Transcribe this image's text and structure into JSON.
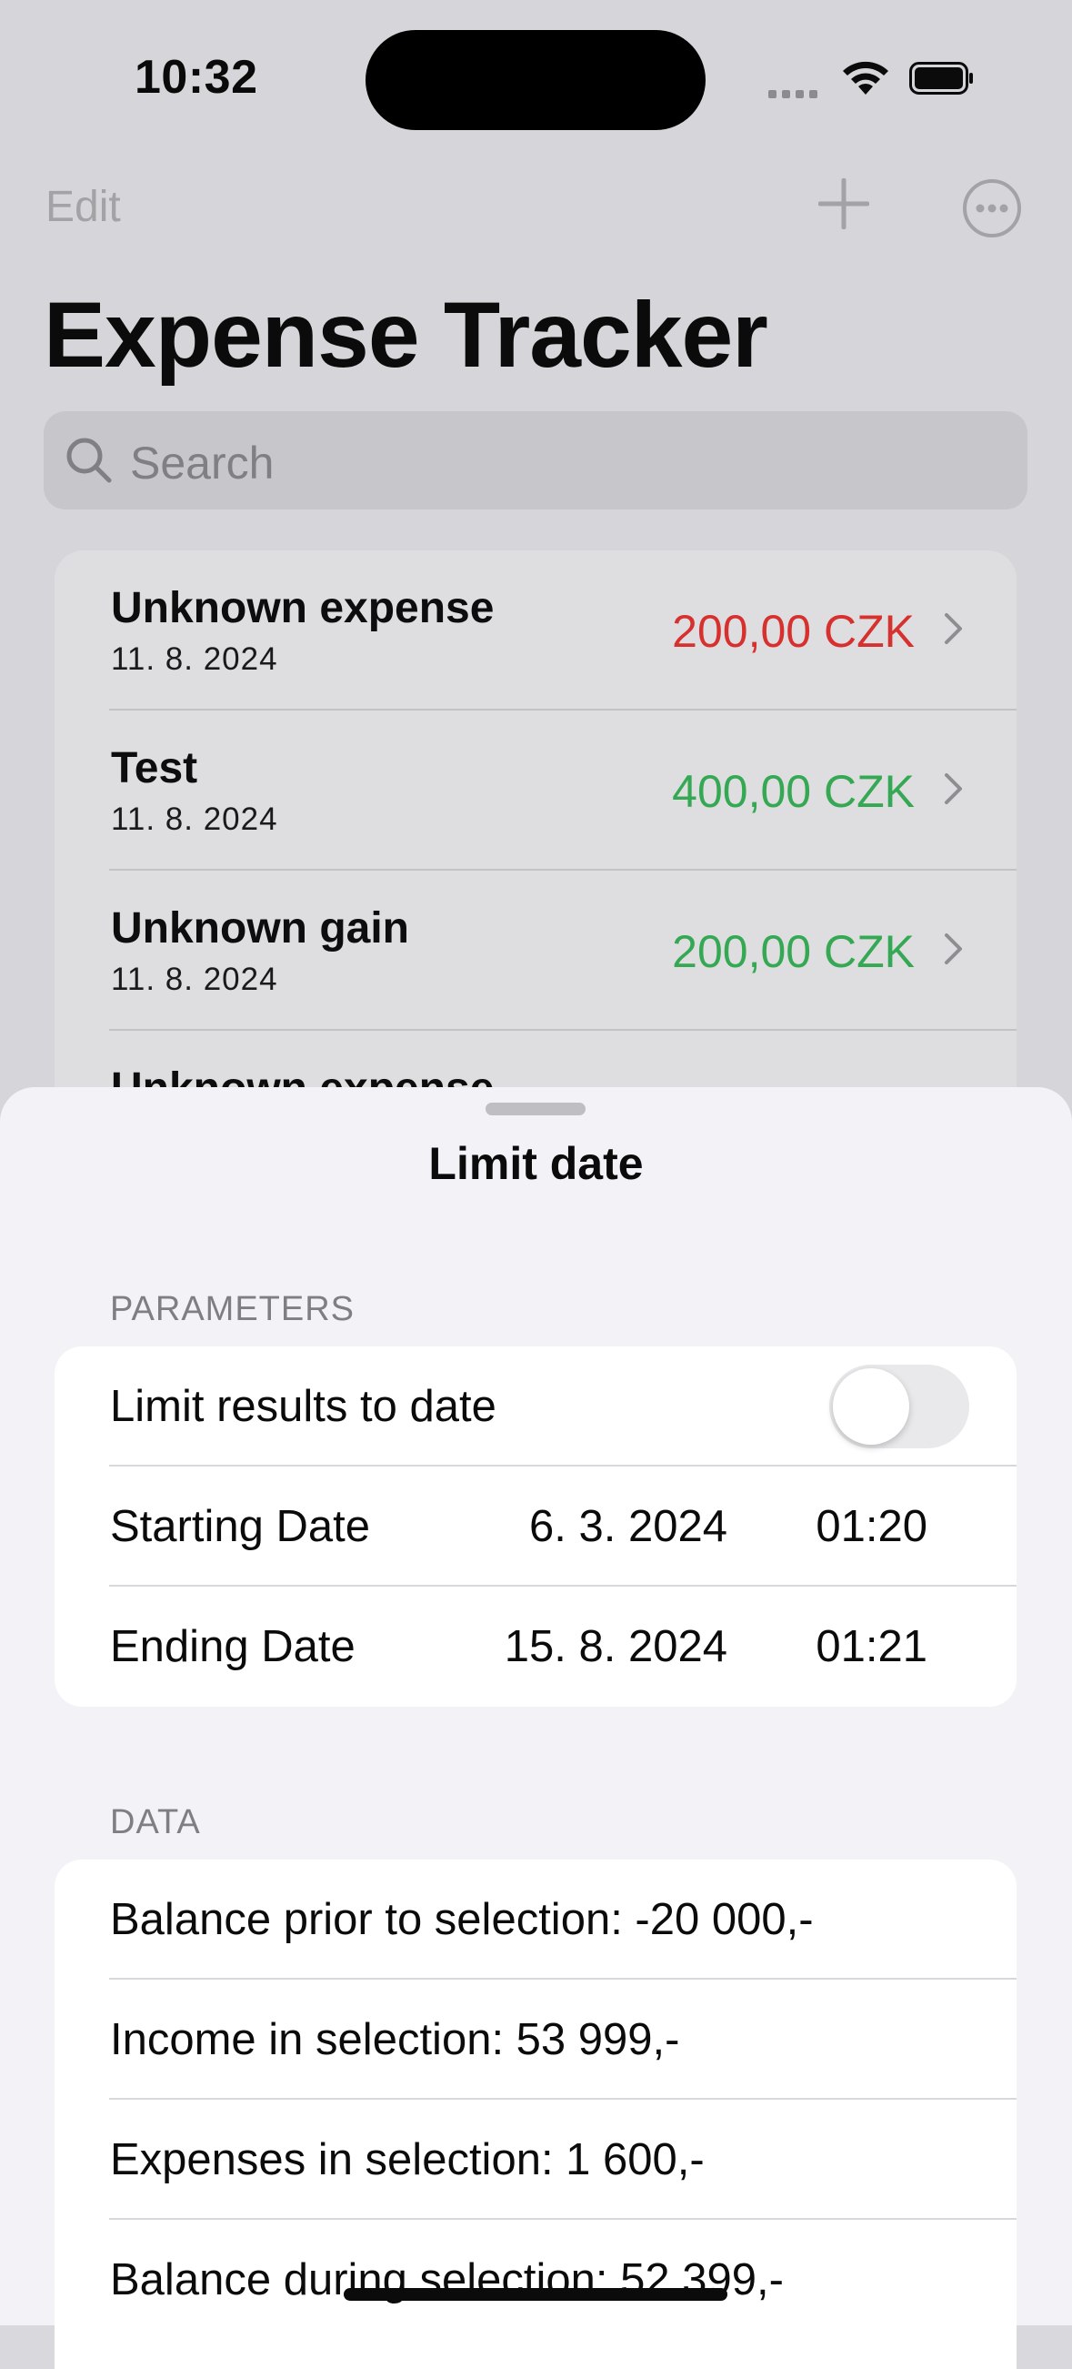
{
  "status_bar": {
    "time": "10:32"
  },
  "nav": {
    "edit_label": "Edit",
    "add_icon": "plus-icon",
    "more_icon": "ellipsis-circle-icon"
  },
  "page": {
    "title": "Expense Tracker"
  },
  "search": {
    "placeholder": "Search"
  },
  "transactions": [
    {
      "name": "Unknown expense",
      "date": "11. 8. 2024",
      "amount": "200,00 CZK",
      "type": "expense"
    },
    {
      "name": "Test",
      "date": "11. 8. 2024",
      "amount": "400,00 CZK",
      "type": "income"
    },
    {
      "name": "Unknown gain",
      "date": "11. 8. 2024",
      "amount": "200,00 CZK",
      "type": "income"
    },
    {
      "name": "Unknown expense",
      "date": "",
      "amount": "",
      "type": "expense"
    }
  ],
  "sheet": {
    "title": "Limit date",
    "parameters_header": "PARAMETERS",
    "limit_label": "Limit results to date",
    "limit_enabled": false,
    "starting": {
      "label": "Starting Date",
      "date": "6. 3. 2024",
      "time": "01:20"
    },
    "ending": {
      "label": "Ending Date",
      "date": "15. 8. 2024",
      "time": "01:21"
    },
    "data_header": "DATA",
    "data_rows": [
      "Balance prior to selection: -20 000,-",
      "Income in selection: 53 999,-",
      "Expenses in selection: 1 600,-",
      "Balance during selection: 52 399,-"
    ]
  },
  "colors": {
    "expense": "#d6312f",
    "income": "#34a853"
  }
}
